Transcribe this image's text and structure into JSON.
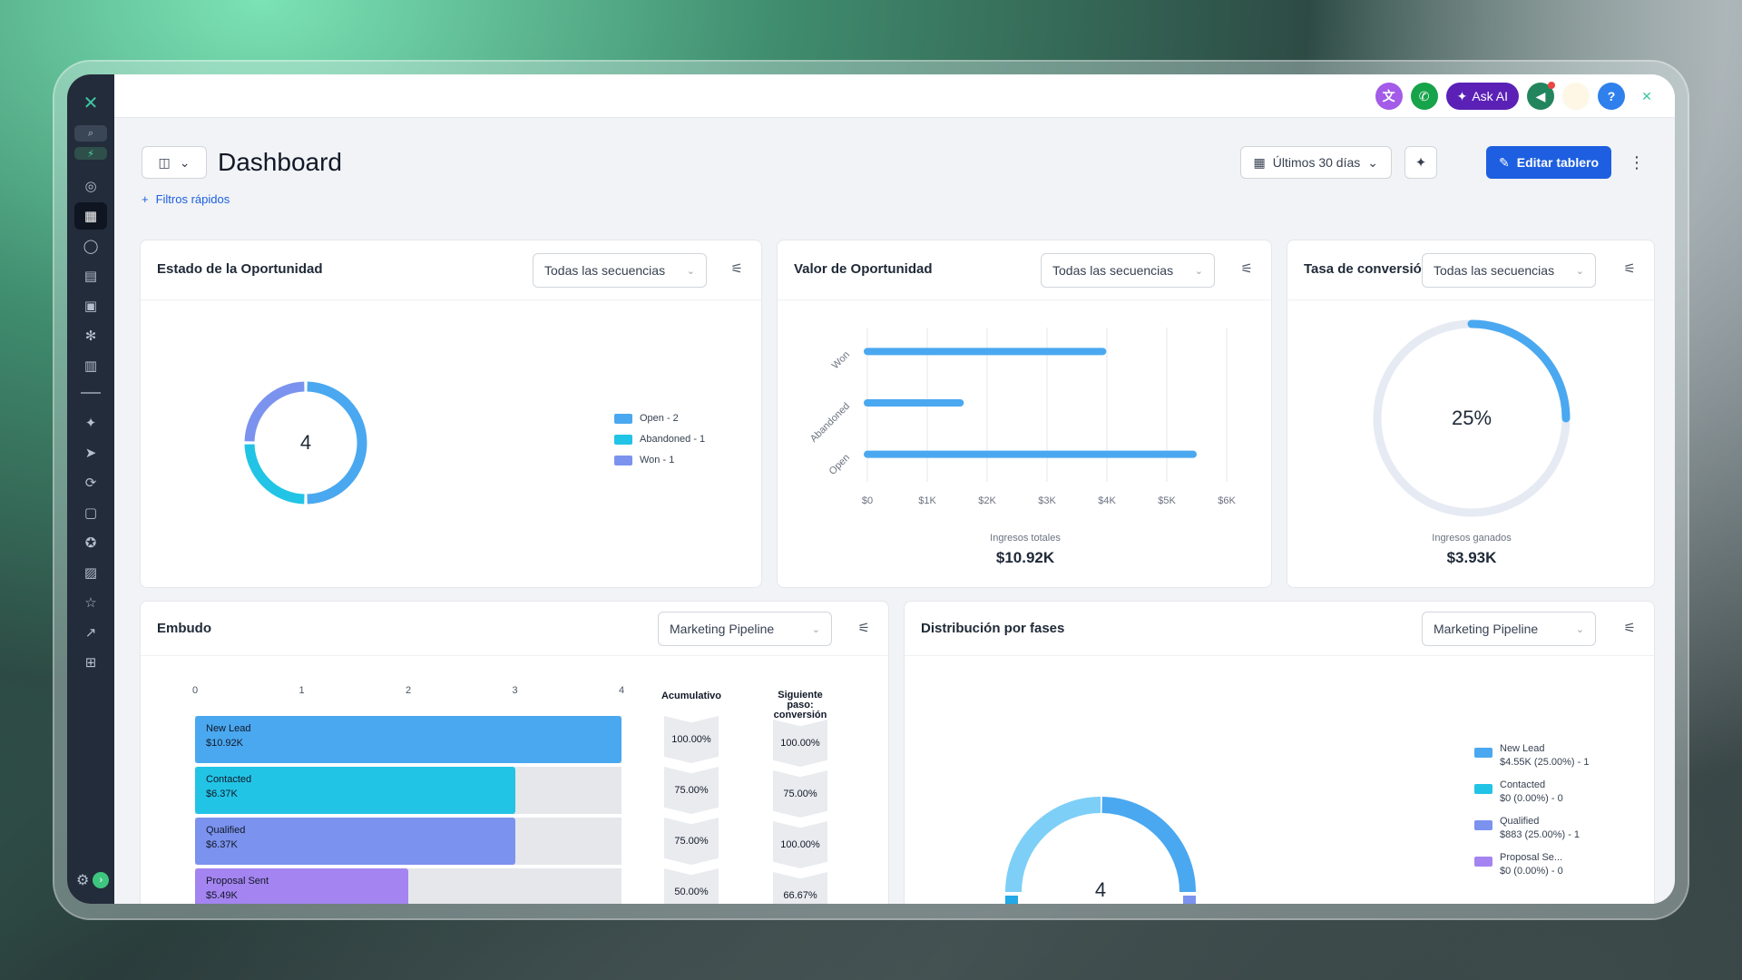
{
  "topbar": {
    "ask_ai_label": "Ask AI",
    "help_label": "?"
  },
  "header": {
    "title": "Dashboard",
    "date_range": "Últimos 30 días",
    "edit_button": "Editar tablero",
    "quick_filters": "Filtros rápidos"
  },
  "cards": {
    "estado": {
      "title": "Estado de la Oportunidad",
      "filter": "Todas las secuencias",
      "center_value": "4",
      "legend": [
        {
          "label": "Open - 2",
          "color": "#4aa8f0"
        },
        {
          "label": "Abandoned - 1",
          "color": "#22c4e6"
        },
        {
          "label": "Won - 1",
          "color": "#7b93ee"
        }
      ]
    },
    "valor": {
      "title": "Valor de Oportunidad",
      "filter": "Todas las secuencias",
      "total_label": "Ingresos totales",
      "total_value": "$10.92K"
    },
    "tasa": {
      "title": "Tasa de conversió",
      "filter": "Todas las secuencias",
      "center_value": "25%",
      "progress_fraction": 0.25,
      "won_label": "Ingresos ganados",
      "won_value": "$3.93K"
    },
    "embudo": {
      "title": "Embudo",
      "filter": "Marketing Pipeline",
      "ticks": [
        "0",
        "1",
        "2",
        "3",
        "4"
      ],
      "col_acumulativo": "Acumulativo",
      "col_siguiente": "Siguiente paso: conversión",
      "stages": [
        {
          "name": "New Lead",
          "value": "$10.92K",
          "count": 4,
          "color": "#4aa8f0",
          "acum": "100.00%",
          "next": "100.00%"
        },
        {
          "name": "Contacted",
          "value": "$6.37K",
          "count": 3,
          "color": "#22c4e6",
          "acum": "75.00%",
          "next": "75.00%"
        },
        {
          "name": "Qualified",
          "value": "$6.37K",
          "count": 3,
          "color": "#7b93ee",
          "acum": "75.00%",
          "next": "100.00%"
        },
        {
          "name": "Proposal Sent",
          "value": "$5.49K",
          "count": 2,
          "color": "#a484f0",
          "acum": "50.00%",
          "next": "66.67%"
        }
      ]
    },
    "distribucion": {
      "title": "Distribución por fases",
      "filter": "Marketing Pipeline",
      "center_value": "4",
      "legend": [
        {
          "name": "New Lead",
          "detail": "$4.55K (25.00%) - 1",
          "color": "#4aa8f0"
        },
        {
          "name": "Contacted",
          "detail": "$0 (0.00%) - 0",
          "color": "#22c4e6"
        },
        {
          "name": "Qualified",
          "detail": "$883 (25.00%) - 1",
          "color": "#7b93ee"
        },
        {
          "name": "Proposal Se...",
          "detail": "$0 (0.00%) - 0",
          "color": "#a484f0"
        }
      ]
    }
  },
  "chart_data": [
    {
      "type": "pie",
      "title": "Estado de la Oportunidad",
      "categories": [
        "Open",
        "Abandoned",
        "Won"
      ],
      "values": [
        2,
        1,
        1
      ]
    },
    {
      "type": "bar",
      "title": "Valor de Oportunidad",
      "orientation": "horizontal",
      "categories": [
        "Won",
        "Abandoned",
        "Open"
      ],
      "values": [
        3930,
        1550,
        5440
      ],
      "xlim": [
        0,
        6000
      ],
      "xticks": [
        "$0",
        "$1K",
        "$2K",
        "$3K",
        "$4K",
        "$5K",
        "$6K"
      ],
      "color": "#4aa8f0"
    },
    {
      "type": "bar",
      "title": "Embudo",
      "orientation": "horizontal",
      "categories": [
        "New Lead",
        "Contacted",
        "Qualified",
        "Proposal Sent"
      ],
      "values": [
        4,
        3,
        3,
        2
      ],
      "xlim": [
        0,
        4
      ]
    },
    {
      "type": "pie",
      "title": "Distribución por fases",
      "categories": [
        "New Lead",
        "Contacted",
        "Qualified",
        "Proposal Se..."
      ],
      "values": [
        1,
        0,
        1,
        0
      ]
    }
  ]
}
